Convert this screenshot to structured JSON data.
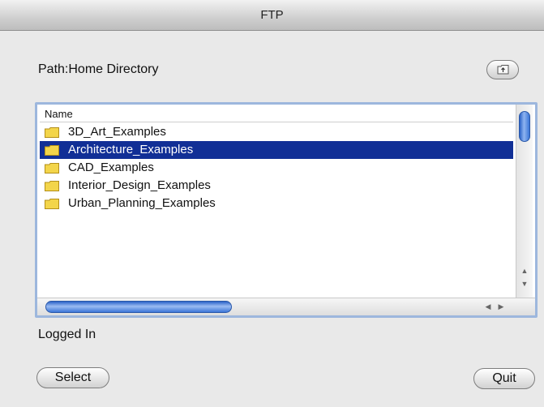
{
  "window": {
    "title": "FTP"
  },
  "path": {
    "label": "Path:Home Directory"
  },
  "icons": {
    "up_directory": "folder-up-icon",
    "folder": "folder-icon"
  },
  "file_list": {
    "column_header": "Name",
    "items": [
      {
        "label": "3D_Art_Examples",
        "selected": false
      },
      {
        "label": "Architecture_Examples",
        "selected": true
      },
      {
        "label": "CAD_Examples",
        "selected": false
      },
      {
        "label": "Interior_Design_Examples",
        "selected": false
      },
      {
        "label": "Urban_Planning_Examples",
        "selected": false
      }
    ]
  },
  "status": {
    "text": "Logged In"
  },
  "buttons": {
    "select_label": "Select",
    "quit_label": "Quit"
  },
  "colors": {
    "selection": "#112f96",
    "folder": "#f3d54a",
    "focus_ring": "#9db7dd"
  }
}
